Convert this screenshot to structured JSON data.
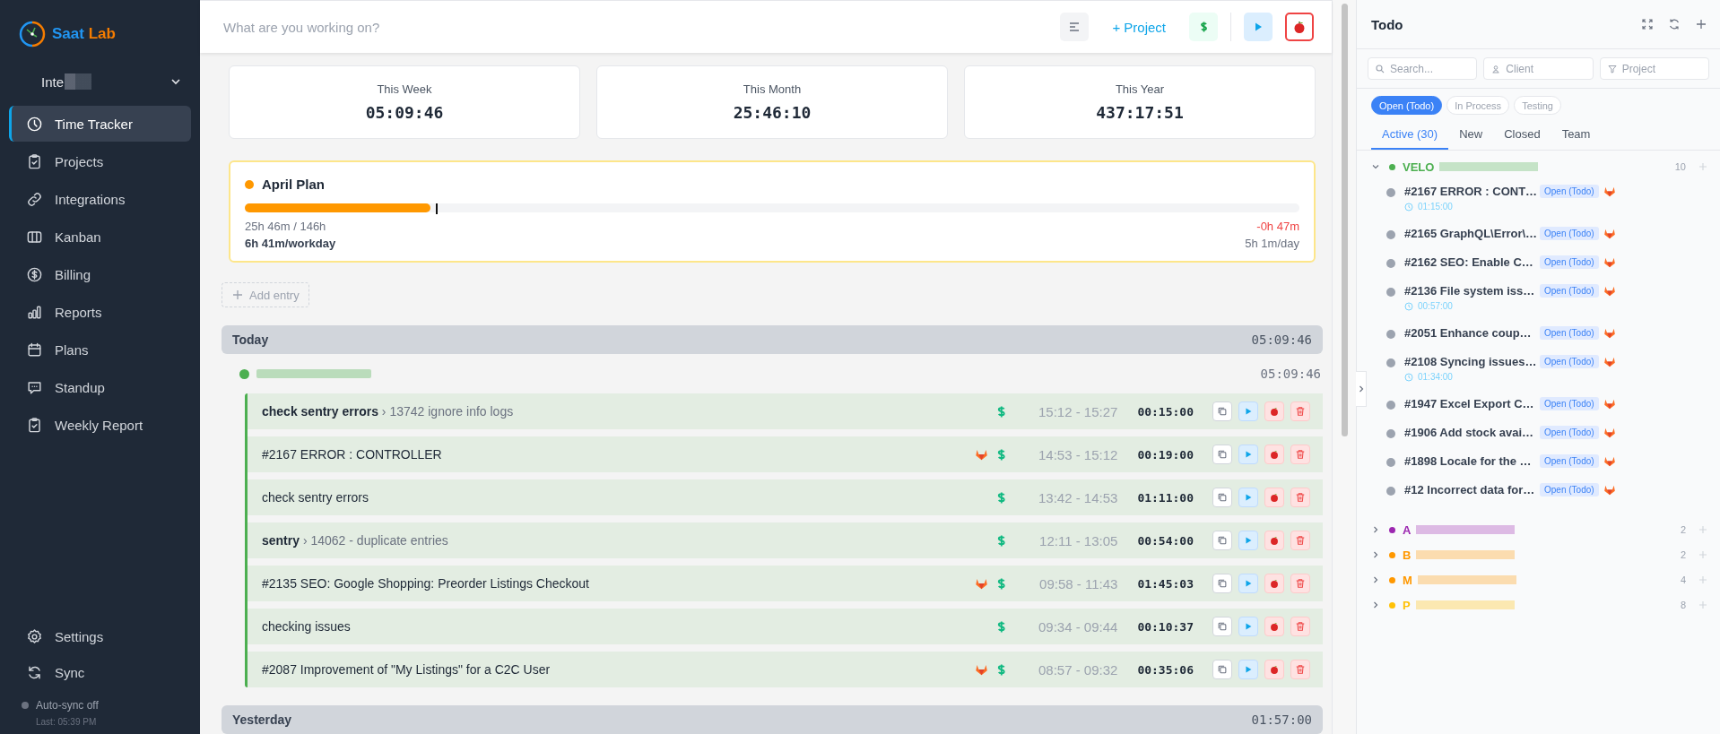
{
  "sidebar": {
    "brand": {
      "first": "Saat",
      "second": "Lab"
    },
    "workspace": "Inte",
    "nav": [
      {
        "label": "Time Tracker",
        "kind": "clock",
        "selected": true
      },
      {
        "label": "Projects",
        "kind": "clipboard",
        "selected": false
      },
      {
        "label": "Integrations",
        "kind": "link",
        "selected": false
      },
      {
        "label": "Kanban",
        "kind": "columns",
        "selected": false
      },
      {
        "label": "Billing",
        "kind": "dollar",
        "selected": false
      },
      {
        "label": "Reports",
        "kind": "bars",
        "selected": false
      },
      {
        "label": "Plans",
        "kind": "calendar",
        "selected": false
      },
      {
        "label": "Standup",
        "kind": "chat",
        "selected": false
      },
      {
        "label": "Weekly Report",
        "kind": "clipboard",
        "selected": false
      }
    ],
    "bottom": [
      {
        "label": "Settings",
        "kind": "gear"
      },
      {
        "label": "Sync",
        "kind": "sync"
      }
    ],
    "sync_status": {
      "on": false,
      "text": "Auto-sync off",
      "last": "Last: 05:39 PM"
    }
  },
  "timer_bar": {
    "placeholder": "What are you working on?",
    "project_button": "+ Project",
    "billable": true
  },
  "stats": [
    {
      "label": "This Week",
      "value": "05:09:46"
    },
    {
      "label": "This Month",
      "value": "25:46:10"
    },
    {
      "label": "This Year",
      "value": "437:17:51"
    }
  ],
  "plan": {
    "title": "April Plan",
    "level": 0.176,
    "logged": "25h 46m / 146h",
    "pace": "6h 41m/workday",
    "delta": "-0h 47m",
    "delta_negative": true,
    "required": "5h 1m/day"
  },
  "add_entry": "Add entry",
  "days": [
    {
      "label": "Today",
      "total": "05:09:46",
      "projects": [
        {
          "color": "#4caf50",
          "total": "05:09:46",
          "entries": [
            {
              "title": "check sentry errors",
              "subtask": "› 13742 ignore info logs",
              "gitlab": false,
              "billable": true,
              "range": "15:12 - 15:27",
              "duration": "00:15:00"
            },
            {
              "title": "#2167 ERROR : CONTROLLER",
              "gitlab": true,
              "billable": true,
              "range": "14:53 - 15:12",
              "duration": "00:19:00"
            },
            {
              "title": "check sentry errors",
              "gitlab": false,
              "billable": true,
              "range": "13:42 - 14:53",
              "duration": "01:11:00"
            },
            {
              "title": "sentry",
              "subtask": "› 14062 - duplicate entries",
              "gitlab": false,
              "billable": true,
              "range": "12:11 - 13:05",
              "duration": "00:54:00"
            },
            {
              "title": "#2135 SEO: Google Shopping: Preorder Listings Checkout",
              "gitlab": true,
              "billable": true,
              "range": "09:58 - 11:43",
              "duration": "01:45:03"
            },
            {
              "title": "checking issues",
              "gitlab": false,
              "billable": true,
              "range": "09:34 - 09:44",
              "duration": "00:10:37"
            },
            {
              "title": "#2087 Improvement of \"My Listings\" for a C2C User",
              "gitlab": true,
              "billable": true,
              "range": "08:57 - 09:32",
              "duration": "00:35:06"
            }
          ]
        }
      ]
    },
    {
      "label": "Yesterday",
      "total": "01:57:00"
    }
  ],
  "todo": {
    "title": "Todo",
    "search": {
      "placeholder": "Search..."
    },
    "client": {
      "placeholder": "Client"
    },
    "project": {
      "placeholder": "Project"
    },
    "status_chips": [
      {
        "label": "Open (Todo)",
        "selected": true
      },
      {
        "label": "In Process",
        "selected": false
      },
      {
        "label": "Testing",
        "selected": false
      }
    ],
    "tabs": [
      {
        "label": "Active (30)",
        "selected": true
      },
      {
        "label": "New",
        "selected": false
      },
      {
        "label": "Closed",
        "selected": false
      },
      {
        "label": "Team",
        "selected": false
      }
    ],
    "groups": [
      {
        "name": "VELO",
        "color": "#4caf50",
        "expanded": true,
        "count": "10",
        "items": [
          {
            "title": "#2167 ERROR : CONT…",
            "status": "Open (Todo)",
            "time": "01:15:00"
          },
          {
            "title": "#2165 GraphQL\\Error\\…",
            "status": "Open (Todo)"
          },
          {
            "title": "#2162 SEO: Enable C…",
            "status": "Open (Todo)"
          },
          {
            "title": "#2136 File system iss…",
            "status": "Open (Todo)",
            "time": "00:57:00"
          },
          {
            "title": "#2051 Enhance coup…",
            "status": "Open (Todo)"
          },
          {
            "title": "#2108 Syncing issues…",
            "status": "Open (Todo)",
            "time": "01:34:00"
          },
          {
            "title": "#1947 Excel Export C…",
            "status": "Open (Todo)"
          },
          {
            "title": "#1906 Add stock avai…",
            "status": "Open (Todo)"
          },
          {
            "title": "#1898 Locale for the …",
            "status": "Open (Todo)"
          },
          {
            "title": "#12 Incorrect data for…",
            "status": "Open (Todo)"
          }
        ]
      },
      {
        "name": "A",
        "color": "#9c27b0",
        "expanded": false,
        "count": "2"
      },
      {
        "name": "B",
        "color": "#ff9800",
        "expanded": false,
        "count": "2"
      },
      {
        "name": "M",
        "color": "#ff9800",
        "expanded": false,
        "count": "4"
      },
      {
        "name": "P",
        "color": "#ffc107",
        "expanded": false,
        "count": "8"
      }
    ]
  }
}
